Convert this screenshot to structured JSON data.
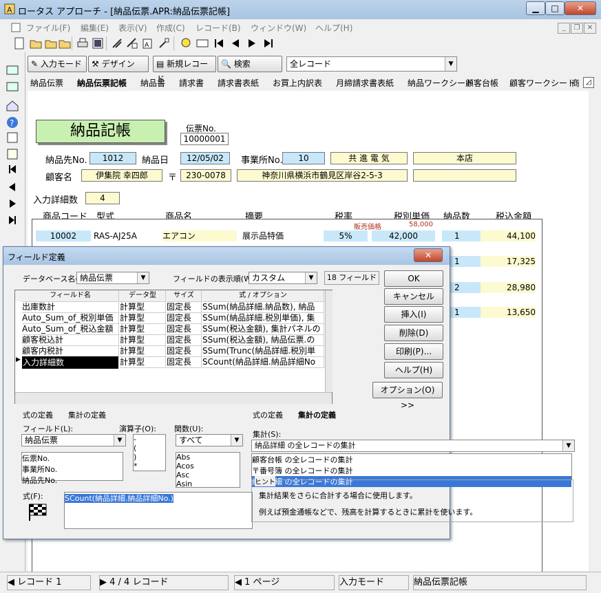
{
  "window": {
    "title": "ロータス アプローチ - [納品伝票.APR:納品伝票記帳]"
  },
  "menu": [
    "ファイル(F)",
    "編集(E)",
    "表示(V)",
    "作成(C)",
    "レコード(B)",
    "ウィンドウ(W)",
    "ヘルプ(H)"
  ],
  "actionbar": {
    "input_mode": "入力モード",
    "design": "デザイン",
    "new_record": "新規レコード",
    "search": "検索",
    "record_filter": "全レコード"
  },
  "tabs": [
    "納品伝票",
    "納品伝票記帳",
    "納品書",
    "請求書",
    "請求書表紙",
    "お買上内訳表",
    "月締請求書表紙",
    "納品ワークシート",
    "顧客台帳",
    "顧客ワークシート",
    "商"
  ],
  "form": {
    "title": "納品記帳",
    "voucher_no_label": "伝票No.",
    "voucher_no": "10000001",
    "dest_no_label": "納品先No.",
    "dest_no": "1012",
    "date_label": "納品日",
    "date": "12/05/02",
    "office_no_label": "事業所No.",
    "office_no": "10",
    "company": "共 進 電 気",
    "branch": "本店",
    "customer_label": "顧客名",
    "customer": "伊集院 幸四郎",
    "postal_mark": "〒",
    "postal": "230-0078",
    "address": "神奈川県横浜市鶴見区岸谷2-5-3",
    "detail_count_label": "入力詳細数",
    "detail_count": "4",
    "columns": [
      "商品コード",
      "型式",
      "商品名",
      "摘要",
      "税率",
      "税別単価",
      "納品数",
      "税込金額"
    ],
    "row1": {
      "code": "10002",
      "model": "RAS-AJ25A",
      "name": "エアコン",
      "note": "展示品特価",
      "rate": "5%",
      "price_label": "販売価格",
      "list_price": "58,000",
      "price": "42,000",
      "qty": "1",
      "total": "44,100"
    },
    "row2": {
      "qty": "1",
      "total": "17,325"
    },
    "row3": {
      "qty": "2",
      "total": "28,980"
    },
    "row4": {
      "qty": "1",
      "total": "13,650"
    }
  },
  "dialog": {
    "title": "フィールド定義",
    "db_label": "データベース名(B):",
    "db_value": "納品伝票",
    "order_label": "フィールドの表示順(W):",
    "order_value": "カスタム",
    "field_count": "18 フィールド",
    "grid_headers": [
      "フィールド名",
      "データ型",
      "サイズ",
      "式 / オプション"
    ],
    "grid_rows": [
      [
        "出庫数計",
        "計算型",
        "固定長",
        "SSum(納品詳細.納品数), 納品"
      ],
      [
        "Auto_Sum_of_税別単価",
        "計算型",
        "固定長",
        "SSum(納品詳細.税別単価), 集"
      ],
      [
        "Auto_Sum_of_税込金額",
        "計算型",
        "固定長",
        "SSum(税込金額), 集計パネルの"
      ],
      [
        "顧客税込計",
        "計算型",
        "固定長",
        "SSum(税込金額), 納品伝票.の"
      ],
      [
        "顧客内税計",
        "計算型",
        "固定長",
        "SSum(Trunc(納品詳細.税別単"
      ],
      [
        "入力詳細数",
        "計算型",
        "固定長",
        "SCount(納品詳細.納品詳細No"
      ]
    ],
    "buttons": [
      "OK",
      "キャンセル",
      "挿入(I)",
      "削除(D)",
      "印刷(P)...",
      "ヘルプ(H)"
    ],
    "options_button": "オプション(O) >>",
    "left_tabs": [
      "式の定義",
      "集計の定義"
    ],
    "right_tabs": [
      "式の定義",
      "集計の定義"
    ],
    "field_label": "フィールド(L):",
    "field_value": "納品伝票",
    "field_list": [
      "伝票No.",
      "事業所No.",
      "納品先No."
    ],
    "operator_label": "演算子(O):",
    "operators": [
      "-",
      "(",
      ")",
      "*"
    ],
    "function_label": "関数(U):",
    "function_value": "すべて",
    "functions": [
      "Abs",
      "Acos",
      "Asc",
      "Asin"
    ],
    "formula_label": "式(F):",
    "formula": "SCount(納品詳細.納品詳細No.)",
    "summary_label": "集計(S):",
    "summary_value": "納品詳細 の全レコードの集計",
    "summary_list": [
      "顧客台帳 の全レコードの集計",
      "〒番号簿 の全レコードの集計",
      "納品詳細 の全レコードの集計"
    ],
    "hint_title": "ヒント",
    "hint_line1": "集計結果をさらに合計する場合に使用します。",
    "hint_line2": "例えば預金通帳などで、残高を計算するときに累計を使います。"
  },
  "status": {
    "record": "レコード 1",
    "count": "4 / 4 レコード",
    "page": "1 ページ",
    "mode": "入力モード",
    "form": "納品伝票記帳"
  }
}
